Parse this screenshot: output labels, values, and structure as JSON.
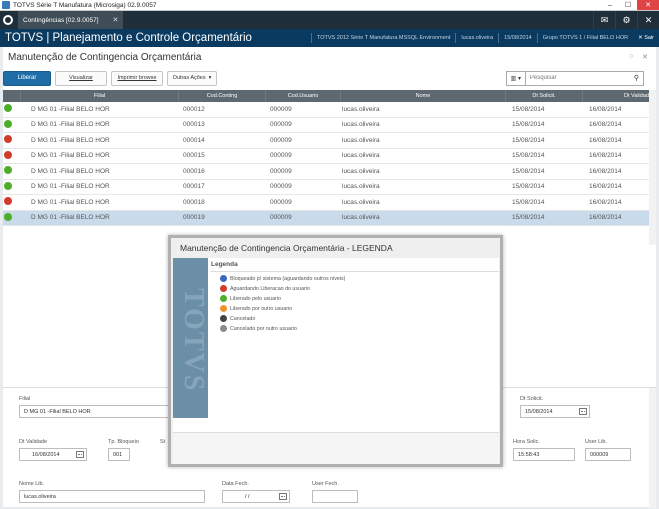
{
  "window": {
    "title": "TOTVS Série T Manufatura (Microsiga) 02.9.0057"
  },
  "tabs": [
    {
      "label": "Contingências [02.9.0057]"
    }
  ],
  "app": {
    "title": "TOTVS | Planejamento e Controle Orçamentário",
    "env": "TOTVS 2012 Série T Manufatura MSSQL Environment",
    "user": "lucas.oliveira",
    "date": "15/08/2014",
    "group": "Grupo TOTVS 1 / Filial BELO HOR",
    "exit": "Sair"
  },
  "page": {
    "title": "Manutenção de Contingencia Orçamentária"
  },
  "toolbar": {
    "liberar": "Liberar",
    "visualizar": "Visualizar",
    "imprimir": "Imprimir browse",
    "outras": "Outras Ações"
  },
  "search": {
    "placeholder": "Pesquisar"
  },
  "grid": {
    "headers": [
      "Filial",
      "Cod.Conting",
      "Cod.Usuario",
      "Nome",
      "Dt Solicit.",
      "Dt Validade"
    ],
    "rows": [
      {
        "status": "green",
        "filial": "D MG 01 -Filial BELO HOR",
        "cod": "000012",
        "usuario": "000009",
        "nome": "lucas.oliveira",
        "solicit": "15/08/2014",
        "validade": "16/08/2014"
      },
      {
        "status": "green",
        "filial": "D MG 01 -Filial BELO HOR",
        "cod": "000013",
        "usuario": "000009",
        "nome": "lucas.oliveira",
        "solicit": "15/08/2014",
        "validade": "16/08/2014"
      },
      {
        "status": "red",
        "filial": "D MG 01 -Filial BELO HOR",
        "cod": "000014",
        "usuario": "000009",
        "nome": "lucas.oliveira",
        "solicit": "15/08/2014",
        "validade": "16/08/2014"
      },
      {
        "status": "red",
        "filial": "D MG 01 -Filial BELO HOR",
        "cod": "000015",
        "usuario": "000009",
        "nome": "lucas.oliveira",
        "solicit": "15/08/2014",
        "validade": "16/08/2014"
      },
      {
        "status": "green",
        "filial": "D MG 01 -Filial BELO HOR",
        "cod": "000016",
        "usuario": "000009",
        "nome": "lucas.oliveira",
        "solicit": "15/08/2014",
        "validade": "16/08/2014"
      },
      {
        "status": "green",
        "filial": "D MG 01 -Filial BELO HOR",
        "cod": "000017",
        "usuario": "000009",
        "nome": "lucas.oliveira",
        "solicit": "15/08/2014",
        "validade": "16/08/2014"
      },
      {
        "status": "red",
        "filial": "D MG 01 -Filial BELO HOR",
        "cod": "000018",
        "usuario": "000009",
        "nome": "lucas.oliveira",
        "solicit": "15/08/2014",
        "validade": "16/08/2014"
      },
      {
        "status": "green",
        "filial": "D MG 01 -Filial BELO HOR",
        "cod": "000019",
        "usuario": "000009",
        "nome": "lucas.oliveira",
        "solicit": "15/08/2014",
        "validade": "16/08/2014",
        "selected": true
      }
    ]
  },
  "detail": {
    "filial_label": "Filial",
    "filial_value": "D MG 01 -Filial BELO HOR",
    "dtsolicit_label": "Dt Solicit.",
    "dtsolicit_value": "15/08/2014",
    "dtvalidade_label": "Dt Validade",
    "dtvalidade_value": "16/08/2014",
    "tpbloqueio_label": "Tp. Bloqueio",
    "tpbloqueio_value": "001",
    "st_label": "St",
    "horasolic_label": "Hora Solic.",
    "horasolic_value": "15:58:43",
    "userlib_label": "User Lib.",
    "userlib_value": "000009",
    "nomelib_label": "Nome Lib.",
    "nomelib_value": "lucas.oliveira",
    "datafech_label": "Data Fech.",
    "datafech_value": "/ /",
    "userfech_label": "User Fech."
  },
  "modal": {
    "title": "Manutenção de Contingencia Orçamentária - LEGENDA",
    "watermark": "TOTVS",
    "legend_title": "Legenda",
    "items": [
      {
        "color": "blue",
        "label": "Bloqueado p/ sistema (aguardando outros niveis)"
      },
      {
        "color": "red",
        "label": "Aguardando Liberacao do usuario"
      },
      {
        "color": "green",
        "label": "Liberado pelo usuario"
      },
      {
        "color": "orange",
        "label": "Liberado por outro usuario"
      },
      {
        "color": "black",
        "label": "Cancelado"
      },
      {
        "color": "gray",
        "label": "Cancelado por outro usuario"
      }
    ]
  },
  "colors": {
    "green": "#4caf2a",
    "red": "#d23a2a",
    "blue": "#3a66c8",
    "orange": "#f0922a",
    "black": "#444444",
    "gray": "#8a8a8a",
    "header": "#0b3a61",
    "primary": "#1f6da6",
    "selected": "#c9daeb"
  },
  "icons": {
    "mail": "mail-icon",
    "settings": "gear-icon",
    "close": "close-icon",
    "search": "search-icon",
    "calendar": "calendar-icon"
  }
}
